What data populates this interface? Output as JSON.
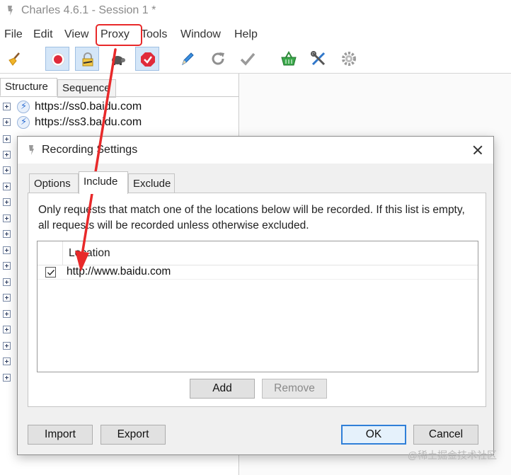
{
  "window": {
    "title": "Charles 4.6.1 - Session 1 *"
  },
  "menu": [
    "File",
    "Edit",
    "View",
    "Proxy",
    "Tools",
    "Window",
    "Help"
  ],
  "toolbar": {
    "icons": [
      "broom-icon",
      "record-icon",
      "lock-icon",
      "turtle-icon",
      "stop-icon",
      "pen-icon",
      "refresh-icon",
      "check-icon",
      "basket-icon",
      "tools-icon",
      "gear-icon"
    ],
    "pressed": [
      "record-icon",
      "lock-icon",
      "stop-icon"
    ]
  },
  "left_pane": {
    "tabs": [
      "Structure",
      "Sequence"
    ],
    "tree": [
      "https://ss0.baidu.com",
      "https://ss3.baidu.com"
    ]
  },
  "dialog": {
    "title": "Recording Settings",
    "tabs": [
      "Options",
      "Include",
      "Exclude"
    ],
    "active_tab": "Include",
    "description": "Only requests that match one of the locations below will be recorded. If this list is empty, all requests will be recorded unless otherwise excluded.",
    "table": {
      "column": "Location",
      "rows": [
        {
          "checked": true,
          "location": "http://www.baidu.com"
        }
      ]
    },
    "add_label": "Add",
    "remove_label": "Remove",
    "import_label": "Import",
    "export_label": "Export",
    "ok_label": "OK",
    "cancel_label": "Cancel"
  },
  "annotation": {
    "highlight_color": "#e8292a"
  },
  "watermark": "@稀土掘金技术社区"
}
